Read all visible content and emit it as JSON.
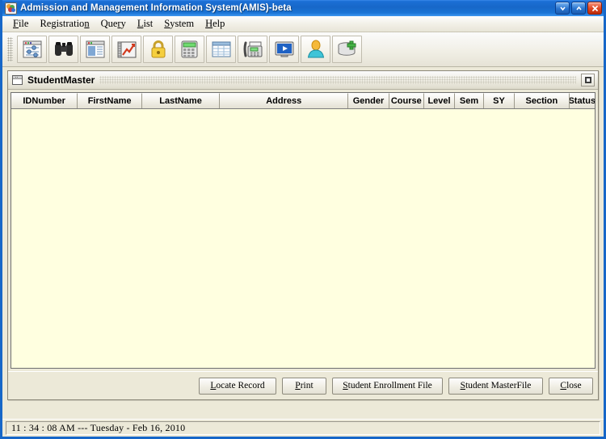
{
  "window": {
    "title": "Admission and Management Information System(AMIS)-beta",
    "icon": "amis-app-icon",
    "controls": [
      {
        "name": "minimize-button",
        "glyph": "minimize-icon"
      },
      {
        "name": "maximize-button",
        "glyph": "maximize-icon"
      },
      {
        "name": "close-button",
        "glyph": "close-icon"
      }
    ]
  },
  "menubar": {
    "items": [
      {
        "label": "File",
        "mnemonic_index": 0
      },
      {
        "label": "Registration",
        "mnemonic_index": 11
      },
      {
        "label": "Query",
        "mnemonic_index": 3
      },
      {
        "label": "List",
        "mnemonic_index": 0
      },
      {
        "label": "System",
        "mnemonic_index": 0
      },
      {
        "label": "Help",
        "mnemonic_index": 0
      }
    ]
  },
  "toolbar": {
    "grip": "drag-grip",
    "buttons": [
      {
        "name": "settings-list-button",
        "icon": "settings-window-icon"
      },
      {
        "name": "search-button",
        "icon": "binoculars-icon"
      },
      {
        "name": "document-window-button",
        "icon": "document-window-icon"
      },
      {
        "name": "report-chart-button",
        "icon": "notebook-chart-icon"
      },
      {
        "name": "security-button",
        "icon": "padlock-icon"
      },
      {
        "name": "calculator-button",
        "icon": "calculator-icon"
      },
      {
        "name": "grid-table-button",
        "icon": "table-grid-icon"
      },
      {
        "name": "fax-button",
        "icon": "fax-machine-icon"
      },
      {
        "name": "run-monitor-button",
        "icon": "monitor-play-icon"
      },
      {
        "name": "user-button",
        "icon": "user-person-icon"
      },
      {
        "name": "add-database-button",
        "icon": "database-add-icon"
      }
    ]
  },
  "internal_frame": {
    "title": "StudentMaster",
    "icon": "window-icon",
    "restore_button": "restore-icon"
  },
  "table": {
    "columns": [
      {
        "label": "IDNumber",
        "width": 88
      },
      {
        "label": "FirstName",
        "width": 85
      },
      {
        "label": "LastName",
        "width": 103
      },
      {
        "label": "Address",
        "width": 170
      },
      {
        "label": "Gender",
        "width": 54
      },
      {
        "label": "Course",
        "width": 46
      },
      {
        "label": "Level",
        "width": 41
      },
      {
        "label": "Sem",
        "width": 38
      },
      {
        "label": "SY",
        "width": 41
      },
      {
        "label": "Section",
        "width": 72
      },
      {
        "label": "Status",
        "width": 56
      }
    ],
    "rows": [],
    "background_color": "#ffffe0"
  },
  "buttons": [
    {
      "name": "locate-record-button",
      "label": "Locate Record",
      "mnemonic_index": 0,
      "width": 96
    },
    {
      "name": "print-button",
      "label": "Print",
      "mnemonic_index": 0,
      "width": 55
    },
    {
      "name": "student-enrollment-file-button",
      "label": "Student Enrollment File",
      "mnemonic_index": 0,
      "width": 137
    },
    {
      "name": "student-masterfile-button",
      "label": "Student MasterFile",
      "mnemonic_index": 0,
      "width": 117
    },
    {
      "name": "close-button-bottom",
      "label": "Close",
      "mnemonic_index": 0,
      "width": 55
    }
  ],
  "statusbar": {
    "text": "11 : 34 : 08 AM ---   Tuesday - Feb 16, 2010"
  },
  "colors": {
    "titlebar_blue": "#1767c8",
    "frame_border": "#1767c8",
    "desktop": "#ece9d8",
    "table_body": "#ffffe0"
  }
}
